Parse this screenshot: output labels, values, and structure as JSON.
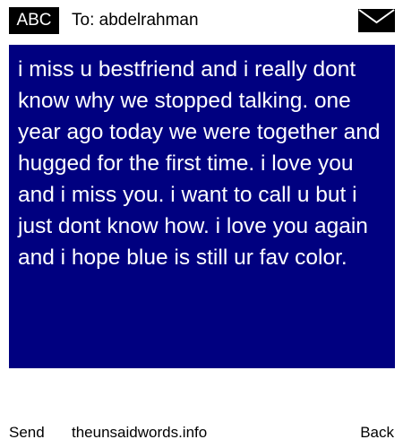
{
  "header": {
    "badge_label": "ABC",
    "to_label": "To: abdelrahman",
    "mail_icon": "envelope-icon"
  },
  "message": {
    "body": "i miss u bestfriend and i really dont know why we stopped talking. one year ago today we were together and hugged for the first time. i love you and i miss you. i want to call u but i just dont know how. i love you again and i hope blue is still ur fav color.",
    "background_color": "#000080",
    "text_color": "#ffffff"
  },
  "footer": {
    "send_label": "Send",
    "site_label": "theunsaidwords.info",
    "back_label": "Back"
  }
}
